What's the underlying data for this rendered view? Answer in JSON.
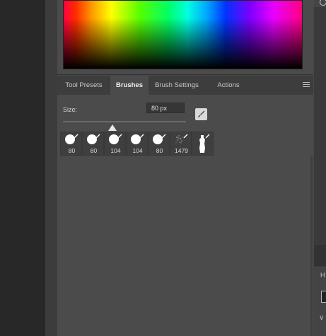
{
  "panel": {
    "tabs": [
      {
        "label": "Tool Presets"
      },
      {
        "label": "Brushes"
      },
      {
        "label": "Brush Settings"
      },
      {
        "label": "Actions"
      }
    ],
    "active_tab": "Brushes",
    "menu_icon": "hamburger-menu-icon"
  },
  "brushes_panel": {
    "size_label": "Size:",
    "size_value": "80 px",
    "create_brush_icon": "brush-icon",
    "slider_fraction": 0.4,
    "presets": [
      {
        "size": "80",
        "icon": "round-brush-icon"
      },
      {
        "size": "80",
        "icon": "round-brush-icon"
      },
      {
        "size": "104",
        "icon": "round-brush-icon"
      },
      {
        "size": "104",
        "icon": "round-brush-icon"
      },
      {
        "size": "80",
        "icon": "round-brush-icon"
      },
      {
        "size": "1479",
        "icon": "spatter-brush-icon"
      },
      {
        "size": "",
        "icon": "figure-brush-icon"
      }
    ]
  },
  "right_panel": {
    "label": "H"
  },
  "colors": {
    "panel_bg": "#4b4b4b",
    "tab_bar_bg": "#3d3d3d",
    "active_tab_bg": "#4b4b4b",
    "workspace_bg": "#282828"
  }
}
